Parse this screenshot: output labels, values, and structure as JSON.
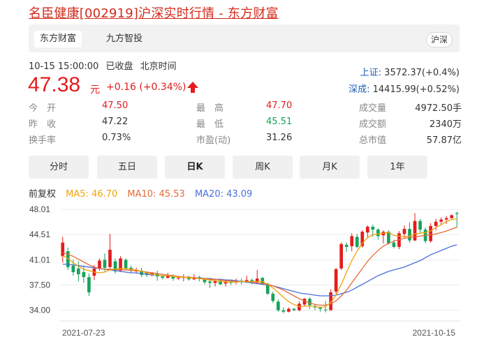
{
  "page": {
    "title": "名臣健康[002919]沪深实时行情 - 东方财富"
  },
  "tabs": [
    {
      "label": "东方财富",
      "active": true
    },
    {
      "label": "九方智投",
      "active": false
    }
  ],
  "market_badge": "沪深",
  "quote": {
    "time": "10-15 15:00:00",
    "status": "已收盘",
    "timezone": "北京时间",
    "price": "47.38",
    "unit": "元",
    "change": "+0.16",
    "change_pct": "(+0.34%)",
    "direction": "up"
  },
  "indices": [
    {
      "name": "上证:",
      "value": "3572.37(+0.4%)"
    },
    {
      "name": "深成:",
      "value": "14415.99(+0.52%)"
    }
  ],
  "stats": [
    [
      {
        "label": "今　开",
        "value": "47.50",
        "color": "red"
      },
      {
        "label": "最　高",
        "value": "47.70",
        "color": "red"
      },
      {
        "label": "成交量",
        "value": "4972.50手",
        "color": "dark"
      }
    ],
    [
      {
        "label": "昨　收",
        "value": "47.22",
        "color": "dark"
      },
      {
        "label": "最　低",
        "value": "45.51",
        "color": "green"
      },
      {
        "label": "成交额",
        "value": "2340万",
        "color": "dark"
      }
    ],
    [
      {
        "label": "换手率",
        "value": "0.73%",
        "color": "dark"
      },
      {
        "label": "市盈(动)",
        "value": "31.26",
        "color": "dark"
      },
      {
        "label": "总市值",
        "value": "57.87亿",
        "color": "dark"
      }
    ]
  ],
  "periods": [
    {
      "label": "分时",
      "active": false
    },
    {
      "label": "五日",
      "active": false
    },
    {
      "label": "日K",
      "active": true
    },
    {
      "label": "周K",
      "active": false
    },
    {
      "label": "月K",
      "active": false
    },
    {
      "label": "1年",
      "active": false
    }
  ],
  "legend": {
    "adjust": "前复权",
    "ma5": "MA5: 46.70",
    "ma10": "MA10: 45.53",
    "ma20": "MA20: 43.09"
  },
  "colors": {
    "up": "#e41c1c",
    "down": "#17a35a",
    "ma5": "#f0a30a",
    "ma10": "#e66b3a",
    "ma20": "#4a6fd9"
  },
  "chart_data": {
    "type": "candlestick",
    "y_ticks": [
      "48.01",
      "44.51",
      "41.01",
      "37.50",
      "34.00"
    ],
    "ylim": [
      32.9,
      48.6
    ],
    "x_labels": [
      "2021-07-23",
      "2021-10-15"
    ],
    "candles": [
      [
        41.5,
        43.4,
        40.6,
        44.2
      ],
      [
        42.2,
        40.0,
        39.6,
        42.7
      ],
      [
        40.2,
        39.3,
        38.8,
        41.0
      ],
      [
        39.8,
        39.0,
        38.0,
        40.8
      ],
      [
        39.3,
        38.6,
        37.8,
        40.2
      ],
      [
        38.6,
        36.5,
        36.0,
        39.1
      ],
      [
        38.8,
        39.8,
        38.2,
        40.3
      ],
      [
        39.8,
        40.9,
        39.5,
        41.2
      ],
      [
        41.0,
        39.9,
        39.4,
        41.9
      ],
      [
        40.0,
        42.4,
        39.8,
        44.6
      ],
      [
        40.8,
        39.4,
        39.1,
        41.2
      ],
      [
        39.5,
        41.2,
        39.3,
        41.5
      ],
      [
        41.0,
        39.8,
        39.5,
        41.2
      ],
      [
        39.9,
        39.6,
        39.2,
        40.2
      ],
      [
        39.5,
        39.5,
        39.1,
        39.9
      ],
      [
        39.5,
        38.9,
        38.6,
        39.9
      ],
      [
        39.2,
        38.9,
        38.6,
        39.4
      ],
      [
        38.9,
        39.2,
        38.7,
        39.3
      ],
      [
        39.1,
        38.7,
        38.1,
        39.5
      ],
      [
        38.7,
        38.5,
        38.3,
        38.9
      ],
      [
        38.5,
        38.8,
        38.4,
        39.2
      ],
      [
        38.8,
        38.4,
        38.1,
        39.0
      ],
      [
        38.4,
        38.5,
        38.2,
        38.7
      ],
      [
        38.5,
        38.6,
        38.0,
        39.0
      ],
      [
        38.6,
        38.3,
        38.1,
        38.8
      ],
      [
        38.3,
        38.6,
        38.2,
        39.0
      ],
      [
        38.6,
        38.4,
        38.0,
        38.8
      ],
      [
        38.4,
        37.9,
        37.6,
        38.5
      ],
      [
        38.0,
        37.8,
        37.1,
        38.3
      ],
      [
        37.8,
        38.1,
        37.3,
        38.4
      ],
      [
        38.1,
        37.6,
        37.5,
        38.3
      ],
      [
        37.7,
        38.0,
        37.3,
        38.3
      ],
      [
        38.0,
        37.8,
        37.5,
        38.2
      ],
      [
        37.9,
        38.1,
        37.6,
        38.4
      ],
      [
        38.1,
        37.9,
        37.6,
        38.4
      ],
      [
        38.0,
        38.2,
        37.8,
        38.8
      ],
      [
        38.2,
        37.8,
        37.6,
        38.4
      ],
      [
        37.9,
        38.4,
        37.7,
        39.6
      ],
      [
        38.5,
        37.7,
        37.5,
        38.6
      ],
      [
        37.7,
        36.3,
        36.1,
        37.8
      ],
      [
        36.3,
        35.3,
        35.0,
        36.6
      ],
      [
        35.2,
        34.0,
        33.8,
        35.5
      ],
      [
        34.0,
        33.8,
        33.6,
        34.4
      ],
      [
        33.8,
        34.2,
        33.7,
        34.4
      ],
      [
        34.2,
        34.0,
        33.9,
        34.3
      ],
      [
        34.0,
        34.9,
        33.9,
        35.2
      ],
      [
        34.8,
        35.6,
        34.5,
        35.7
      ],
      [
        35.6,
        34.7,
        34.2,
        35.8
      ],
      [
        34.6,
        34.4,
        34.0,
        34.9
      ],
      [
        34.4,
        34.2,
        33.8,
        34.5
      ],
      [
        34.1,
        34.0,
        33.7,
        35.3
      ],
      [
        34.0,
        36.5,
        34.0,
        36.9
      ],
      [
        36.6,
        39.7,
        36.3,
        39.9
      ],
      [
        39.8,
        43.2,
        39.6,
        43.4
      ],
      [
        43.1,
        42.8,
        42.1,
        43.4
      ],
      [
        42.9,
        44.3,
        42.2,
        44.7
      ],
      [
        44.2,
        42.8,
        42.6,
        44.6
      ],
      [
        42.9,
        44.9,
        42.7,
        45.1
      ],
      [
        44.8,
        45.6,
        44.0,
        45.8
      ],
      [
        45.6,
        45.2,
        44.2,
        45.9
      ],
      [
        45.2,
        44.3,
        43.8,
        45.4
      ],
      [
        44.4,
        44.9,
        43.3,
        45.1
      ],
      [
        44.9,
        43.3,
        43.1,
        45.1
      ],
      [
        43.4,
        42.8,
        42.6,
        43.8
      ],
      [
        42.8,
        44.7,
        42.5,
        45.0
      ],
      [
        44.6,
        45.3,
        44.1,
        45.8
      ],
      [
        45.3,
        43.7,
        43.4,
        46.2
      ],
      [
        43.7,
        46.4,
        43.6,
        47.5
      ],
      [
        46.4,
        45.2,
        44.8,
        46.7
      ],
      [
        45.2,
        43.6,
        43.3,
        45.5
      ],
      [
        43.6,
        45.7,
        43.4,
        46.1
      ],
      [
        45.7,
        46.3,
        45.1,
        46.7
      ],
      [
        46.3,
        46.6,
        45.8,
        46.9
      ],
      [
        46.6,
        46.8,
        46.0,
        47.1
      ],
      [
        46.8,
        47.2,
        46.7,
        47.3
      ],
      [
        47.5,
        47.38,
        45.51,
        47.7
      ]
    ],
    "ma5": [
      41.6,
      41.2,
      40.6,
      40.1,
      39.7,
      39.5,
      39.3,
      39.2,
      39.3,
      39.6,
      39.7,
      39.8,
      39.8,
      39.7,
      39.6,
      39.4,
      39.2,
      39.0,
      38.9,
      38.8,
      38.8,
      38.7,
      38.6,
      38.6,
      38.5,
      38.5,
      38.4,
      38.3,
      38.2,
      38.1,
      38.0,
      37.9,
      37.9,
      37.9,
      38.0,
      38.0,
      38.0,
      38.0,
      38.0,
      37.6,
      37.1,
      36.5,
      35.8,
      35.2,
      34.8,
      34.5,
      34.6,
      34.6,
      34.5,
      34.4,
      34.5,
      35.1,
      36.1,
      37.6,
      39.3,
      40.9,
      42.2,
      43.3,
      44.1,
      44.5,
      44.6,
      44.7,
      44.8,
      44.4,
      44.3,
      44.2,
      44.3,
      44.6,
      44.7,
      44.8,
      45.0,
      45.5,
      45.9,
      46.3,
      46.6,
      46.7
    ],
    "ma10": [
      42.0,
      41.8,
      41.5,
      41.1,
      40.7,
      40.3,
      40.0,
      39.8,
      39.7,
      39.7,
      39.7,
      39.6,
      39.6,
      39.5,
      39.5,
      39.4,
      39.3,
      39.2,
      39.1,
      39.0,
      38.9,
      38.8,
      38.7,
      38.6,
      38.6,
      38.5,
      38.4,
      38.4,
      38.3,
      38.3,
      38.2,
      38.1,
      38.1,
      38.0,
      38.0,
      38.0,
      37.9,
      37.8,
      37.7,
      37.6,
      37.4,
      37.1,
      36.8,
      36.4,
      36.0,
      35.6,
      35.3,
      35.0,
      34.8,
      34.7,
      34.7,
      34.9,
      35.3,
      36.0,
      36.8,
      37.8,
      38.8,
      39.8,
      40.8,
      41.6,
      42.3,
      42.9,
      43.3,
      43.6,
      43.8,
      44.0,
      44.1,
      44.2,
      44.3,
      44.4,
      44.5,
      44.6,
      44.8,
      45.0,
      45.3,
      45.53
    ],
    "ma20": [
      40.4,
      40.4,
      40.3,
      40.2,
      40.1,
      40.0,
      39.9,
      39.8,
      39.7,
      39.6,
      39.5,
      39.4,
      39.3,
      39.2,
      39.2,
      39.1,
      39.0,
      38.9,
      38.9,
      38.8,
      38.8,
      38.7,
      38.7,
      38.6,
      38.6,
      38.5,
      38.5,
      38.4,
      38.4,
      38.3,
      38.3,
      38.2,
      38.2,
      38.1,
      38.0,
      37.9,
      37.8,
      37.7,
      37.6,
      37.5,
      37.4,
      37.2,
      37.0,
      36.8,
      36.6,
      36.4,
      36.3,
      36.2,
      36.1,
      36.0,
      36.0,
      36.0,
      36.1,
      36.3,
      36.5,
      36.8,
      37.2,
      37.6,
      38.0,
      38.4,
      38.8,
      39.1,
      39.4,
      39.6,
      39.8,
      40.0,
      40.3,
      40.6,
      40.9,
      41.3,
      41.7,
      42.0,
      42.3,
      42.6,
      42.9,
      43.09
    ]
  }
}
